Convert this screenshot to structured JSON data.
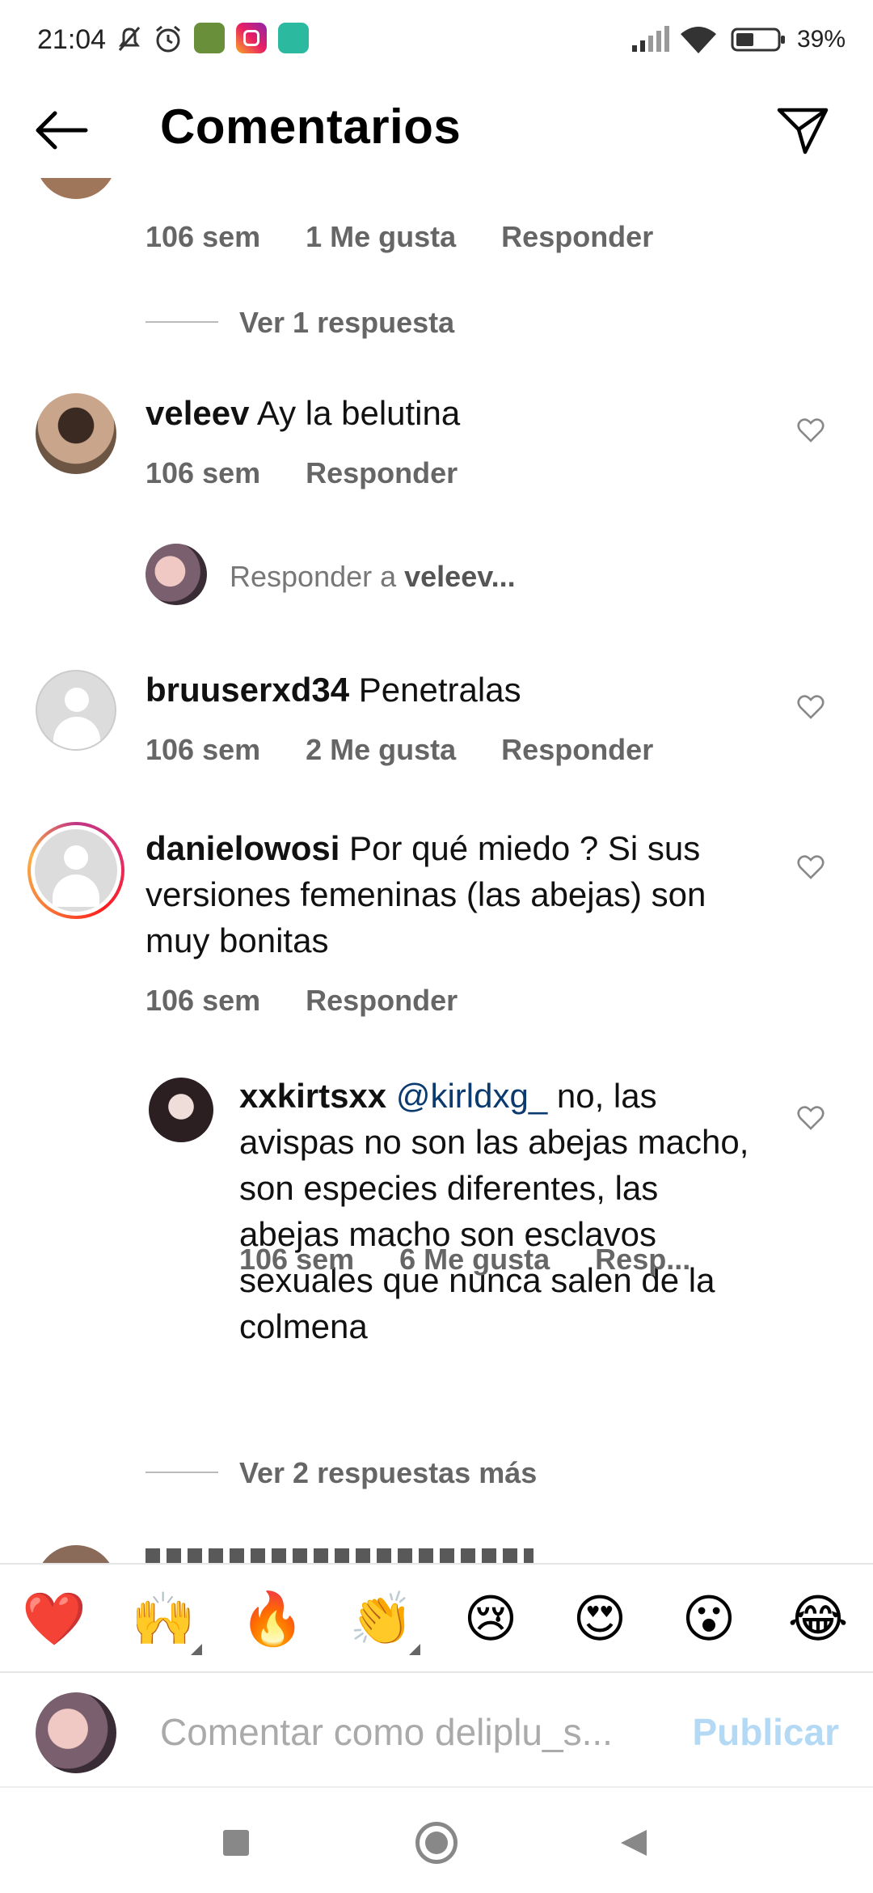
{
  "status_bar": {
    "time": "21:04",
    "battery": "39%"
  },
  "header": {
    "title": "Comentarios"
  },
  "comments": {
    "c0": {
      "time": "106 sem",
      "likes": "1 Me gusta",
      "reply": "Responder",
      "view_replies": "Ver 1 respuesta"
    },
    "c1": {
      "user": "veleev",
      "text": "Ay la belutina",
      "time": "106 sem",
      "reply": "Responder"
    },
    "reply_prompt": {
      "prefix": "Responder a ",
      "user": "veleev..."
    },
    "c2": {
      "user": "bruuserxd34",
      "text": "Penetralas",
      "time": "106 sem",
      "likes": "2 Me gusta",
      "reply": "Responder"
    },
    "c3": {
      "user": "danielowosi",
      "text": "Por qué miedo ? Si sus versiones femeninas (las abejas) son muy bonitas",
      "time": "106 sem",
      "reply": "Responder"
    },
    "c4": {
      "user": "xxkirtsxx",
      "mention": "@kirldxg_",
      "text": "no, las avispas no son las abejas macho, son especies diferentes, las abejas macho son esclavos sexuales que nunca salen de la colmena",
      "time": "106 sem",
      "likes": "6 Me gusta",
      "reply": "Resp..."
    },
    "view_more": "Ver 2 respuestas más"
  },
  "emoji_bar": [
    "❤️",
    "🙌",
    "🔥",
    "👏",
    "😢",
    "😍",
    "😮",
    "😂"
  ],
  "composer": {
    "placeholder": "Comentar como deliplu_s...",
    "publish": "Publicar"
  },
  "colors": {
    "link": "#0b3a6e",
    "publish_disabled": "#b3d9f5",
    "meta": "#666666"
  }
}
